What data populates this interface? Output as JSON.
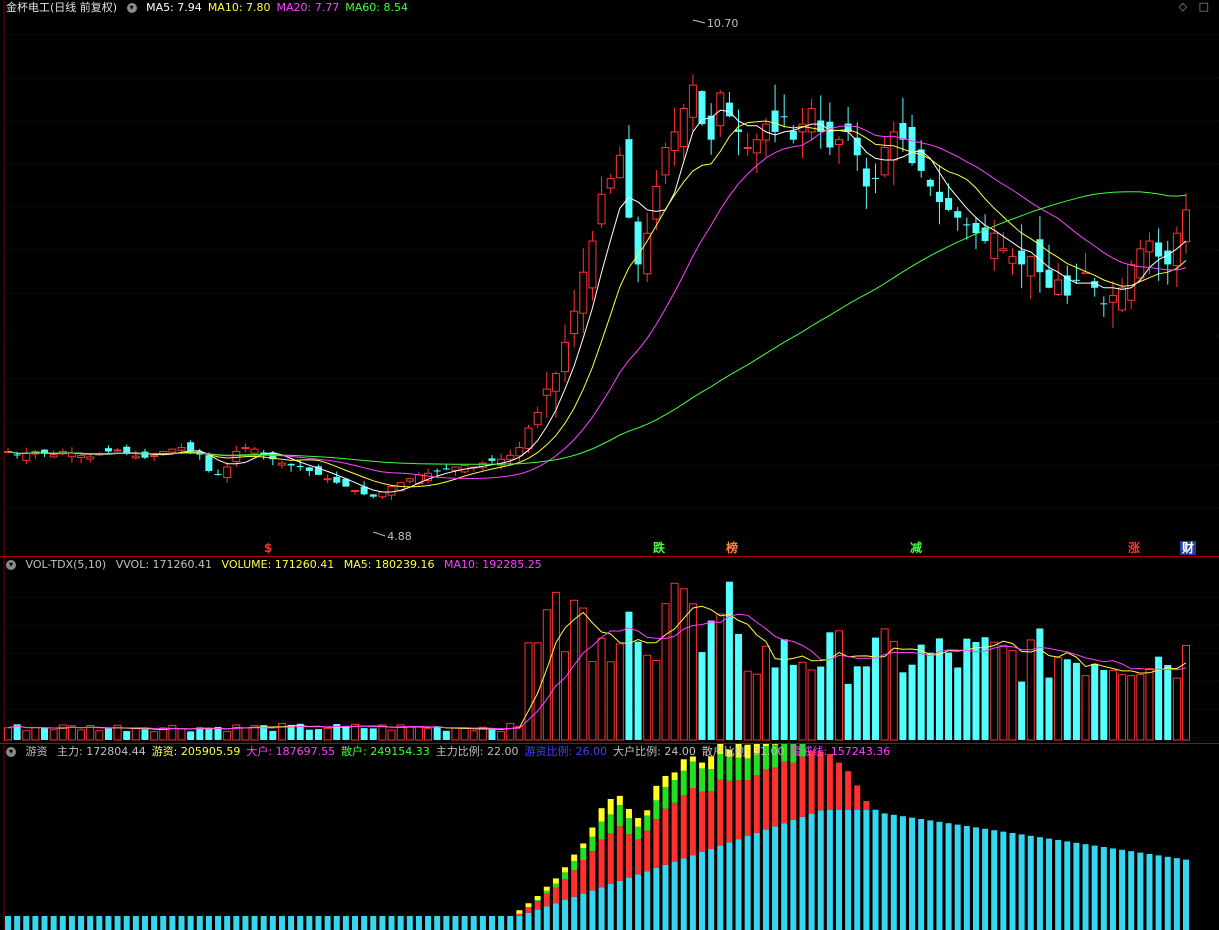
{
  "price_panel": {
    "stock_title": "金杯电工(日线 前复权)",
    "indicators": [
      {
        "label": "MA5: 7.94",
        "color": "#ffffff"
      },
      {
        "label": "MA10: 7.80",
        "color": "#ffff40"
      },
      {
        "label": "MA20: 7.77",
        "color": "#ff40ff"
      },
      {
        "label": "MA60: 8.54",
        "color": "#40ff40"
      }
    ],
    "high_label": "10.70",
    "low_label": "4.88",
    "markers": [
      {
        "text": "$",
        "color": "#ff3030",
        "bg": "none"
      },
      {
        "text": "跌",
        "color": "#40ff40",
        "bg": "none"
      },
      {
        "text": "榜",
        "color": "#ff8040",
        "bg": "none"
      },
      {
        "text": "减",
        "color": "#40ff40",
        "bg": "none"
      },
      {
        "text": "涨",
        "color": "#ff3030",
        "bg": "none"
      },
      {
        "text": "财",
        "color": "#ffffff",
        "bg": "#2040a0"
      }
    ]
  },
  "volume_panel": {
    "name": "VOL-TDX(5,10)",
    "vvol": "VVOL: 171260.41",
    "volume": "VOLUME: 171260.41",
    "ma5": "MA5: 180239.16",
    "ma10": "MA10: 192285.25",
    "colors": {
      "vvol": "#c0c0c0",
      "volume": "#ffff40",
      "ma5": "#ffff40",
      "ma10": "#ff40ff"
    }
  },
  "fund_panel": {
    "name": "游资",
    "items": [
      {
        "label": "主力: 172804.44",
        "color": "#c0c0c0"
      },
      {
        "label": "游资: 205905.59",
        "color": "#ffff40"
      },
      {
        "label": "大户: 187697.55",
        "color": "#ff40ff"
      },
      {
        "label": "散户: 249154.33",
        "color": "#40ff40"
      },
      {
        "label": "主力比例: 22.00",
        "color": "#c0c0c0"
      },
      {
        "label": "游资比例: 26.00",
        "color": "#4040ff"
      },
      {
        "label": "大户比例: 24.00",
        "color": "#c0c0c0"
      },
      {
        "label": "散户比例: 31.00",
        "color": "#c0c0c0"
      },
      {
        "label": "警戒线: 157243.36",
        "color": "#ff40ff"
      }
    ]
  },
  "chart_data": {
    "type": "candlestick",
    "title": "金杯电工(日线 前复权)",
    "close_pattern": [
      5.5,
      5.45,
      5.48,
      5.5,
      5.47,
      5.46,
      5.5,
      5.48,
      5.45,
      5.43,
      5.47,
      5.5,
      5.52,
      5.48,
      5.44,
      5.42,
      5.45,
      5.5,
      5.53,
      5.55,
      5.5,
      5.46,
      5.25,
      5.2,
      5.3,
      5.5,
      5.55,
      5.53,
      5.45,
      5.4,
      5.35,
      5.32,
      5.3,
      5.25,
      5.2,
      5.15,
      5.1,
      5.05,
      5.0,
      4.95,
      4.92,
      4.98,
      5.05,
      5.1,
      5.15,
      5.2,
      5.22,
      5.25,
      5.28,
      5.3,
      5.32,
      5.3,
      5.35,
      5.38,
      5.4,
      5.45,
      5.55,
      5.8,
      6.0,
      6.3,
      6.5,
      6.9,
      7.3,
      7.8,
      8.2,
      8.8,
      9.0,
      9.3,
      8.5,
      7.9,
      8.3,
      8.9,
      9.4,
      9.6,
      9.9,
      10.2,
      9.7,
      9.5,
      10.1,
      9.8,
      9.6,
      9.4,
      9.5,
      9.7,
      9.6,
      9.8,
      9.5,
      9.7,
      9.9,
      9.6,
      9.4,
      9.5,
      9.6,
      9.3,
      8.9,
      9.0,
      9.4,
      9.6,
      9.5,
      9.2,
      9.1,
      8.9,
      8.7,
      8.6,
      8.5,
      8.4,
      8.3,
      8.2,
      8.3,
      8.1,
      8.0,
      7.9,
      8.0,
      7.8,
      7.6,
      7.7,
      7.5,
      7.7,
      7.8,
      7.6,
      7.4,
      7.5,
      7.6,
      7.9,
      8.1,
      8.2,
      8.0,
      7.9,
      8.3,
      8.6
    ]
  }
}
